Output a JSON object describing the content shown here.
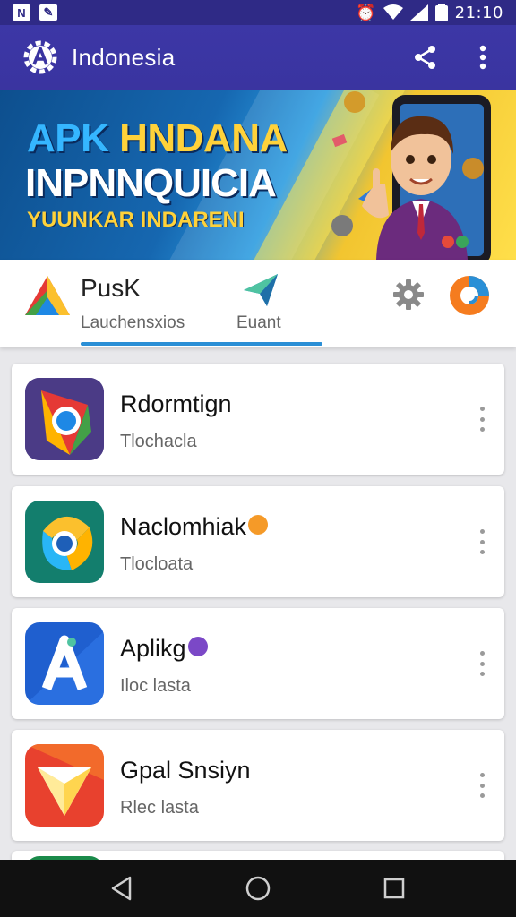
{
  "status_bar": {
    "time": "21:10"
  },
  "app_bar": {
    "title": "Indonesia",
    "share_icon": "share-icon",
    "menu_icon": "more-vert-icon"
  },
  "banner": {
    "line1_a": "APK ",
    "line1_b": "HNDANA",
    "line2": "INPNNQUICIA",
    "line3": "YUUNKAR INDARENI"
  },
  "tabs": [
    {
      "title": "PusK",
      "subtitle": "Lauchensxios",
      "icon": "triangle-logo-icon",
      "active": true
    },
    {
      "title": "",
      "subtitle": "Euant",
      "icon": "paper-plane-icon",
      "active": false
    }
  ],
  "tab_actions": {
    "settings_icon": "gear-icon",
    "profile_icon": "circle-logo-icon"
  },
  "apps": [
    {
      "title": "Rdormtign",
      "subtitle": "Tlochacla",
      "icon": "chrome-style-icon",
      "badge": ""
    },
    {
      "title": "Naclomhiak",
      "subtitle": "Tlocloata",
      "icon": "chrome-swirl-icon",
      "badge": "emoji-badge"
    },
    {
      "title": "Aplikg",
      "subtitle": "Iloc lasta",
      "icon": "letter-a-icon",
      "badge": "heart-badge"
    },
    {
      "title": "Gpal Snsiyn",
      "subtitle": "Rlec lasta",
      "icon": "paper-box-icon",
      "badge": ""
    }
  ],
  "nav": {
    "back_icon": "back-triangle-icon",
    "home_icon": "home-circle-icon",
    "recents_icon": "recents-square-icon"
  },
  "colors": {
    "app_bar": "#3a34a0",
    "status_bar": "#2f2a86",
    "tab_underline": "#2a8fd6",
    "background": "#e8e8eb"
  }
}
